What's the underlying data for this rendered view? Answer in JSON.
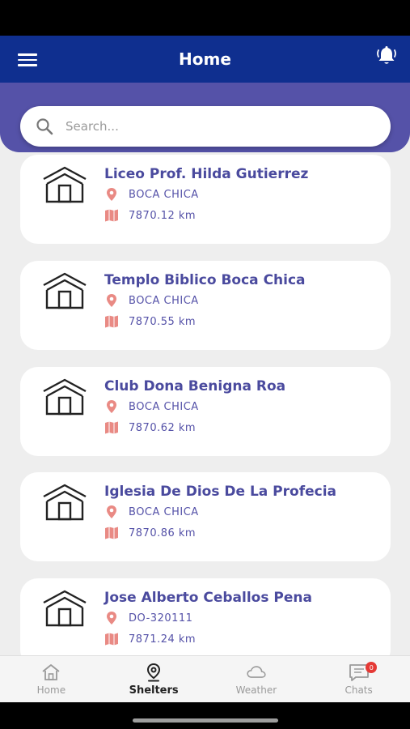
{
  "app_bar": {
    "title": "Home",
    "menu_icon": "menu-icon",
    "bell_icon": "bell-icon"
  },
  "search": {
    "placeholder": "Search...",
    "value": ""
  },
  "colors": {
    "app_bar": "#0f2f8f",
    "header_band": "#5552a8",
    "title_text": "#4a4a9e",
    "pin": "#e98a84"
  },
  "shelters": [
    {
      "name": "Liceo Prof. Hilda Gutierrez",
      "location": "BOCA CHICA",
      "distance": "7870.12 km"
    },
    {
      "name": "Templo Biblico Boca Chica",
      "location": "BOCA CHICA",
      "distance": "7870.55 km"
    },
    {
      "name": "Club Dona Benigna Roa",
      "location": "BOCA CHICA",
      "distance": "7870.62 km"
    },
    {
      "name": "Iglesia De Dios De La Profecia",
      "location": "BOCA CHICA",
      "distance": "7870.86 km"
    },
    {
      "name": "Jose Alberto Ceballos Pena",
      "location": "DO-320111",
      "distance": "7871.24 km"
    }
  ],
  "bottom_nav": [
    {
      "label": "Home",
      "icon": "home-icon",
      "active": false
    },
    {
      "label": "Shelters",
      "icon": "location-pin-icon",
      "active": true
    },
    {
      "label": "Weather",
      "icon": "cloud-icon",
      "active": false
    },
    {
      "label": "Chats",
      "icon": "chat-icon",
      "active": false,
      "badge": "0"
    }
  ]
}
